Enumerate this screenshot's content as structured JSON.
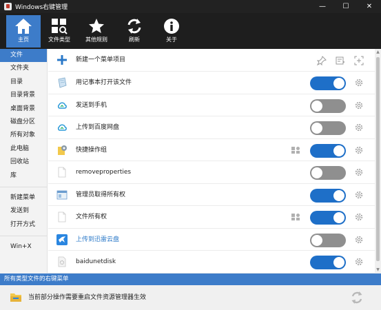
{
  "window": {
    "title": "Windows右键管理",
    "controls": [
      "—",
      "☐",
      "✕"
    ]
  },
  "toolbar": {
    "buttons": [
      {
        "label": "主页",
        "icon": "home-icon",
        "active": true
      },
      {
        "label": "文件类型",
        "icon": "file-types-icon",
        "active": false
      },
      {
        "label": "其他规则",
        "icon": "star-icon",
        "active": false
      },
      {
        "label": "刷新",
        "icon": "refresh-icon",
        "active": false
      },
      {
        "label": "关于",
        "icon": "info-icon",
        "active": false
      }
    ]
  },
  "sidebar": {
    "items": [
      "文件",
      "文件夹",
      "目录",
      "目录背景",
      "桌面背景",
      "磁盘分区",
      "所有对象",
      "此电脑",
      "回收站",
      "库"
    ],
    "items2": [
      "新建菜单",
      "发送到",
      "打开方式"
    ],
    "items3": [
      "Win+X"
    ],
    "active_index": 0
  },
  "main": {
    "new_item_label": "新建一个菜单项目",
    "rows": [
      {
        "label": "用记事本打开该文件",
        "icon": "notepad-icon",
        "on": true,
        "multi": false,
        "link": false
      },
      {
        "label": "发送到手机",
        "icon": "cloud-phone-icon",
        "on": false,
        "multi": false,
        "link": false
      },
      {
        "label": "上传到百度网盘",
        "icon": "cloud-upload-icon",
        "on": false,
        "multi": false,
        "link": false
      },
      {
        "label": "快捷操作组",
        "icon": "folder-gear-icon",
        "on": true,
        "multi": true,
        "link": false
      },
      {
        "label": "removeproperties",
        "icon": "blank-file-icon",
        "on": false,
        "multi": false,
        "link": false
      },
      {
        "label": "管理员取得所有权",
        "icon": "window-icon",
        "on": true,
        "multi": false,
        "link": false
      },
      {
        "label": "文件所有权",
        "icon": "blank-file-icon",
        "on": true,
        "multi": true,
        "link": false
      },
      {
        "label": "上传到迅雷云盘",
        "icon": "thunder-bird-icon",
        "on": false,
        "multi": false,
        "link": true
      },
      {
        "label": "baidunetdisk",
        "icon": "file-settings-icon",
        "on": true,
        "multi": false,
        "link": false
      }
    ]
  },
  "status": {
    "text": "所有类型文件的右键菜单"
  },
  "notice": {
    "text": "当前部分操作需要重启文件资源管理器生效"
  },
  "colors": {
    "accent": "#3d7cc9",
    "toggle_on": "#1e6fc8",
    "toggle_off": "#8f8f8f"
  }
}
